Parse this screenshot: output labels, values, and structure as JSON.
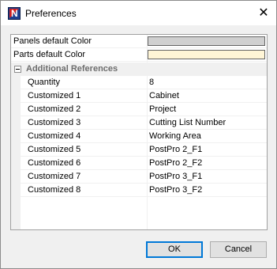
{
  "window": {
    "title": "Preferences",
    "close_glyph": "✕",
    "icon": "app-logo-icon"
  },
  "grid": {
    "color_rows": [
      {
        "label": "Panels default Color",
        "color": "#d0d0d0"
      },
      {
        "label": "Parts default Color",
        "color": "#fff5d6"
      }
    ],
    "category": {
      "label": "Additional References",
      "collapse_icon": "collapse-icon"
    },
    "rows": [
      {
        "label": "Quantity",
        "value": "8"
      },
      {
        "label": "Customized 1",
        "value": "Cabinet"
      },
      {
        "label": "Customized 2",
        "value": "Project"
      },
      {
        "label": "Customized 3",
        "value": "Cutting List Number"
      },
      {
        "label": "Customized 4",
        "value": "Working Area"
      },
      {
        "label": "Customized 5",
        "value": "PostPro 2_F1"
      },
      {
        "label": "Customized 6",
        "value": "PostPro 2_F2"
      },
      {
        "label": "Customized 7",
        "value": "PostPro 3_F1"
      },
      {
        "label": "Customized 8",
        "value": "PostPro 3_F2"
      }
    ]
  },
  "buttons": {
    "ok": "OK",
    "cancel": "Cancel"
  }
}
